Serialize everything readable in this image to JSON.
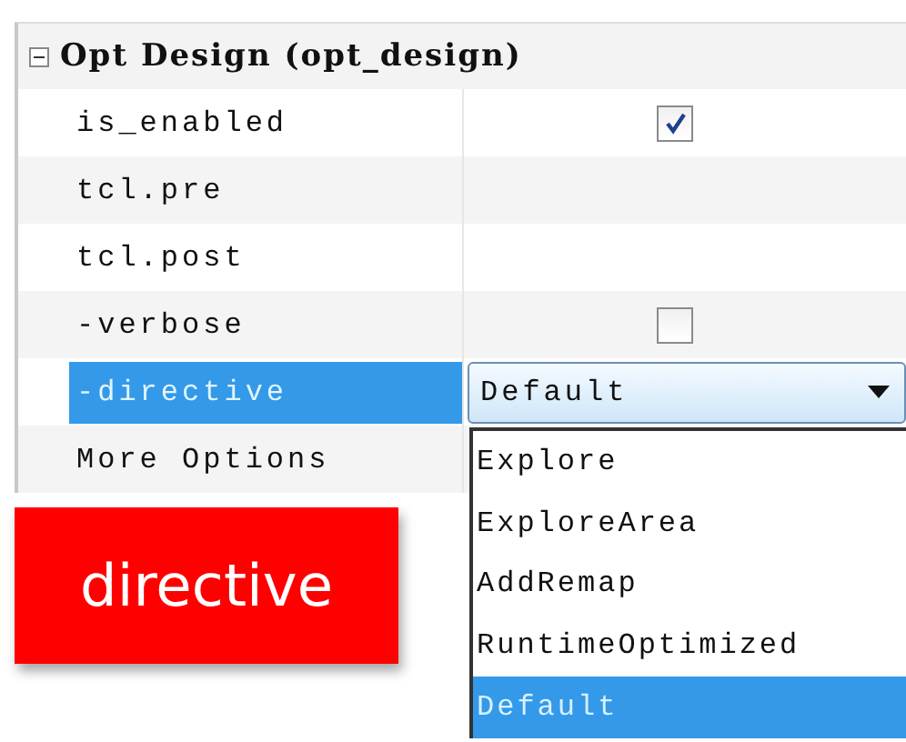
{
  "section": {
    "title": "Opt Design (opt_design)",
    "expanded": true
  },
  "properties": [
    {
      "kind": "checkbox",
      "name": "is_enabled",
      "checked": true,
      "selected": false
    },
    {
      "kind": "text",
      "name": "tcl.pre",
      "selected": false
    },
    {
      "kind": "text",
      "name": "tcl.post",
      "selected": false
    },
    {
      "kind": "checkbox",
      "name": "-verbose",
      "checked": false,
      "selected": false
    },
    {
      "kind": "dropdown",
      "name": "-directive",
      "value": "Default",
      "selected": true
    },
    {
      "kind": "text",
      "name": "More Options",
      "selected": false
    }
  ],
  "dropdown_options": [
    {
      "label": "Explore",
      "selected": false
    },
    {
      "label": "ExploreArea",
      "selected": false
    },
    {
      "label": "AddRemap",
      "selected": false
    },
    {
      "label": "RuntimeOptimized",
      "selected": false
    },
    {
      "label": "Default",
      "selected": true
    }
  ],
  "annotation": {
    "text": "directive"
  }
}
